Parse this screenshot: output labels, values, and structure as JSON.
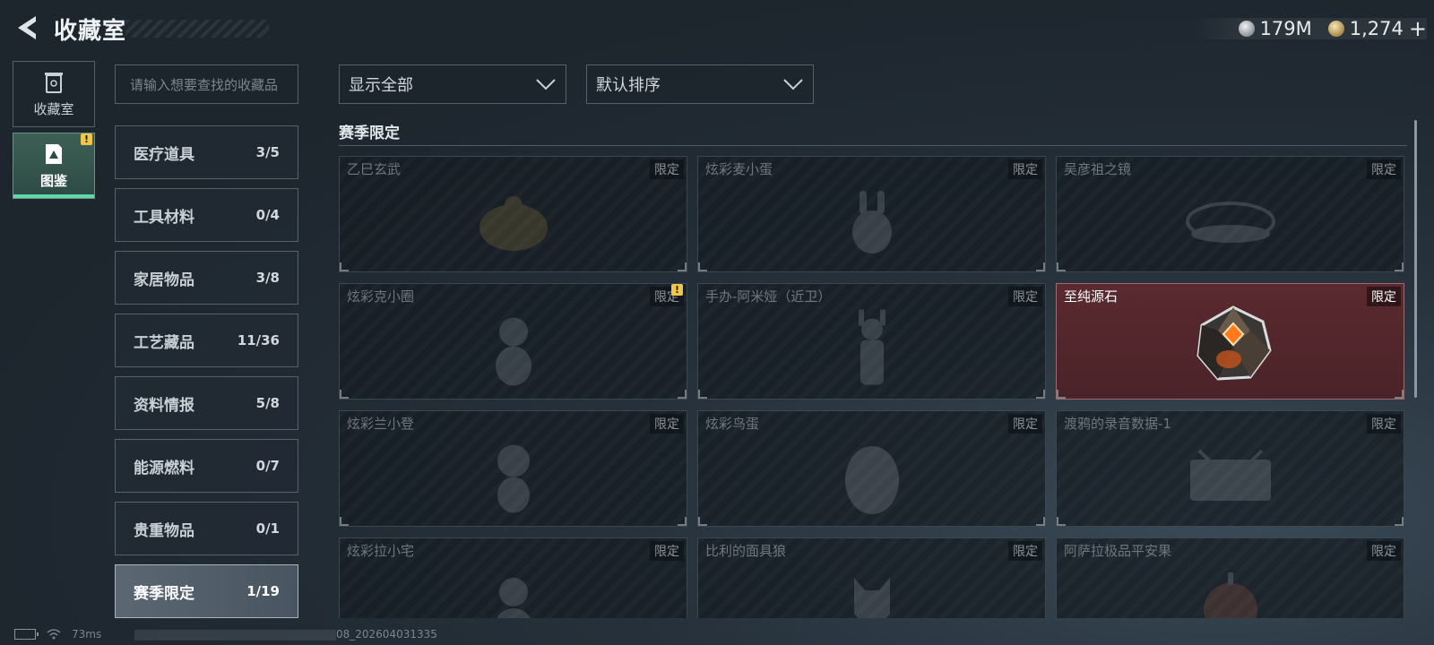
{
  "header": {
    "title": "收藏室",
    "currencies": [
      {
        "icon": "silver-coin-icon",
        "amount": "179M"
      },
      {
        "icon": "gold-coin-icon",
        "amount": "1,274"
      }
    ],
    "plus_label": "+"
  },
  "rail": {
    "items": [
      {
        "label": "收藏室",
        "icon": "trash-bin-icon",
        "active": false
      },
      {
        "label": "图鉴",
        "icon": "codex-icon",
        "active": true,
        "alert": "!"
      }
    ]
  },
  "search": {
    "placeholder": "请输入想要查找的收藏品"
  },
  "filters": {
    "display": "显示全部",
    "sort": "默认排序"
  },
  "categories": [
    {
      "name": "医疗道具",
      "count": "3/5"
    },
    {
      "name": "工具材料",
      "count": "0/4"
    },
    {
      "name": "家居物品",
      "count": "3/8"
    },
    {
      "name": "工艺藏品",
      "count": "11/36"
    },
    {
      "name": "资料情报",
      "count": "5/8"
    },
    {
      "name": "能源燃料",
      "count": "0/7"
    },
    {
      "name": "贵重物品",
      "count": "0/1"
    },
    {
      "name": "赛季限定",
      "count": "1/19",
      "active": true
    }
  ],
  "section": {
    "title": "赛季限定"
  },
  "items": [
    {
      "name": "乙巳玄武",
      "badge": "限定",
      "owned": false
    },
    {
      "name": "炫彩麦小蛋",
      "badge": "限定",
      "owned": false
    },
    {
      "name": "吴彦祖之镜",
      "badge": "限定",
      "owned": false
    },
    {
      "name": "炫彩克小圈",
      "badge": "限定",
      "owned": false,
      "alert": "!"
    },
    {
      "name": "手办-阿米娅（近卫）",
      "badge": "限定",
      "owned": false
    },
    {
      "name": "至纯源石",
      "badge": "限定",
      "owned": true
    },
    {
      "name": "炫彩兰小登",
      "badge": "限定",
      "owned": false
    },
    {
      "name": "炫彩鸟蛋",
      "badge": "限定",
      "owned": false
    },
    {
      "name": "渡鸦的录音数据-1",
      "badge": "限定",
      "owned": false
    },
    {
      "name": "炫彩拉小宅",
      "badge": "限定",
      "owned": false
    },
    {
      "name": "比利的面具狼",
      "badge": "限定",
      "owned": false
    },
    {
      "name": "阿萨拉极品平安果",
      "badge": "限定",
      "owned": false
    }
  ],
  "status": {
    "ping": "73ms",
    "build": "08_202604031335"
  },
  "colors": {
    "accent": "#5fd7a8",
    "owned_tile": "#5a2a30",
    "alert": "#f0c64a"
  }
}
